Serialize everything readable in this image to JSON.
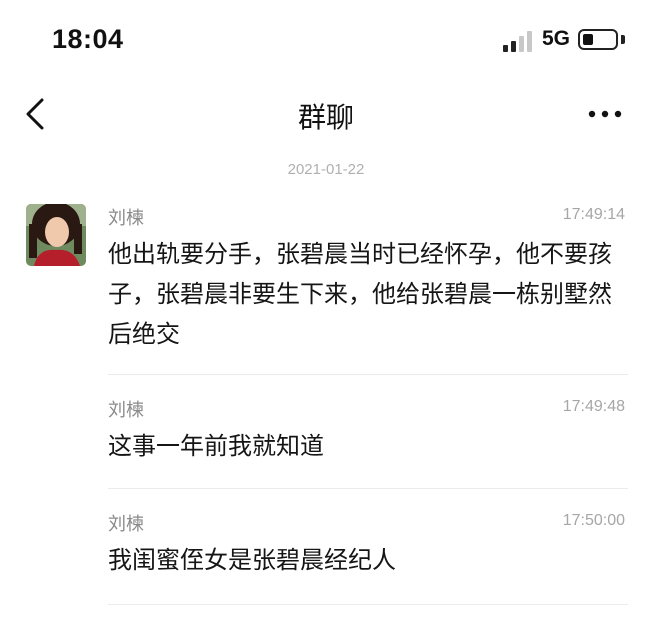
{
  "status_bar": {
    "time": "18:04",
    "network": "5G",
    "signal_icon": "cellular-signal-icon",
    "battery_icon": "battery-icon",
    "battery_level": 0.25
  },
  "nav": {
    "title": "群聊",
    "back_icon": "chevron-left-icon",
    "more_icon": "more-horizontal-icon"
  },
  "date_separator": "2021-01-22",
  "messages": [
    {
      "sender": "刘楝",
      "time": "17:49:14",
      "text": "他出轨要分手，张碧晨当时已经怀孕，他不要孩子，张碧晨非要生下来，他给张碧晨一栋别墅然后绝交"
    },
    {
      "sender": "刘楝",
      "time": "17:49:48",
      "text": "这事一年前我就知道"
    },
    {
      "sender": "刘楝",
      "time": "17:50:00",
      "text": "我闺蜜侄女是张碧晨经纪人"
    }
  ],
  "colors": {
    "background": "#ffffff",
    "text": "#151515",
    "secondary_text": "#8a8a8a",
    "divider": "#ececec"
  }
}
